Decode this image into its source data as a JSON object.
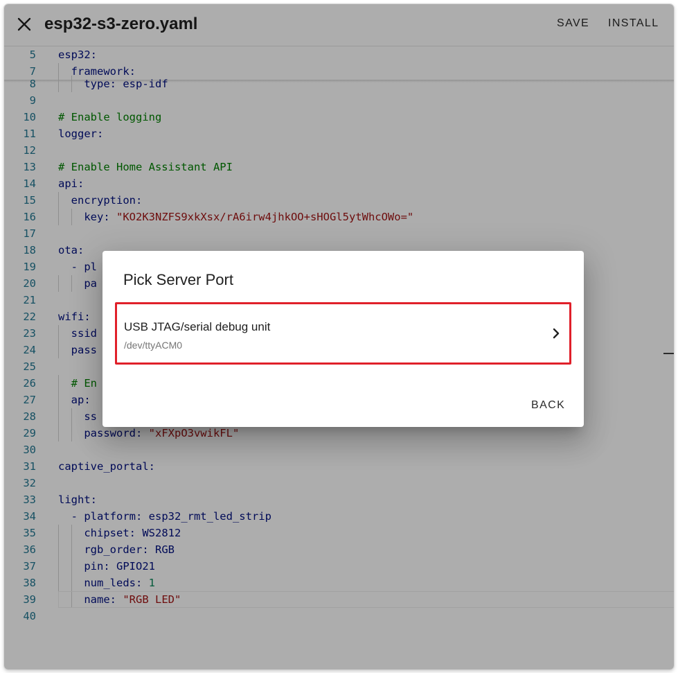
{
  "header": {
    "title": "esp32-s3-zero.yaml",
    "save_label": "SAVE",
    "install_label": "INSTALL",
    "close_icon": "close-icon"
  },
  "editor": {
    "lines": [
      {
        "n": "5",
        "parts": [
          {
            "t": "esp32",
            "c": "k"
          },
          {
            "t": ":",
            "c": "p"
          }
        ]
      },
      {
        "n": "7",
        "parts": [
          {
            "t": "  framework",
            "c": "k"
          },
          {
            "t": ":",
            "c": "p"
          }
        ]
      },
      {
        "n": "8",
        "parts": [
          {
            "t": "    type",
            "c": "k"
          },
          {
            "t": ": ",
            "c": "p"
          },
          {
            "t": "esp-idf",
            "c": "k"
          }
        ]
      },
      {
        "n": "9",
        "parts": []
      },
      {
        "n": "10",
        "parts": [
          {
            "t": "# Enable logging",
            "c": "c"
          }
        ]
      },
      {
        "n": "11",
        "parts": [
          {
            "t": "logger",
            "c": "k"
          },
          {
            "t": ":",
            "c": "p"
          }
        ]
      },
      {
        "n": "12",
        "parts": []
      },
      {
        "n": "13",
        "parts": [
          {
            "t": "# Enable Home Assistant API",
            "c": "c"
          }
        ]
      },
      {
        "n": "14",
        "parts": [
          {
            "t": "api",
            "c": "k"
          },
          {
            "t": ":",
            "c": "p"
          }
        ]
      },
      {
        "n": "15",
        "parts": [
          {
            "t": "  encryption",
            "c": "k"
          },
          {
            "t": ":",
            "c": "p"
          }
        ]
      },
      {
        "n": "16",
        "parts": [
          {
            "t": "    key",
            "c": "k"
          },
          {
            "t": ": ",
            "c": "p"
          },
          {
            "t": "\"KO2K3NZFS9xkXsx/rA6irw4jhkOO+sHOGl5ytWhcOWo=\"",
            "c": "s"
          }
        ]
      },
      {
        "n": "17",
        "parts": []
      },
      {
        "n": "18",
        "parts": [
          {
            "t": "ota",
            "c": "k"
          },
          {
            "t": ":",
            "c": "p"
          }
        ]
      },
      {
        "n": "19",
        "parts": [
          {
            "t": "  - pl",
            "c": "k"
          }
        ]
      },
      {
        "n": "20",
        "parts": [
          {
            "t": "    pa",
            "c": "k"
          }
        ]
      },
      {
        "n": "21",
        "parts": []
      },
      {
        "n": "22",
        "parts": [
          {
            "t": "wifi",
            "c": "k"
          },
          {
            "t": ":",
            "c": "p"
          }
        ]
      },
      {
        "n": "23",
        "parts": [
          {
            "t": "  ssid",
            "c": "k"
          }
        ]
      },
      {
        "n": "24",
        "parts": [
          {
            "t": "  pass",
            "c": "k"
          }
        ]
      },
      {
        "n": "25",
        "parts": []
      },
      {
        "n": "26",
        "parts": [
          {
            "t": "  # En",
            "c": "c"
          }
        ]
      },
      {
        "n": "27",
        "parts": [
          {
            "t": "  ap",
            "c": "k"
          },
          {
            "t": ":",
            "c": "p"
          }
        ]
      },
      {
        "n": "28",
        "parts": [
          {
            "t": "    ss",
            "c": "k"
          }
        ]
      },
      {
        "n": "29",
        "parts": [
          {
            "t": "    password",
            "c": "k"
          },
          {
            "t": ": ",
            "c": "p"
          },
          {
            "t": "\"xFXpO3vwikFL\"",
            "c": "s"
          }
        ]
      },
      {
        "n": "30",
        "parts": []
      },
      {
        "n": "31",
        "parts": [
          {
            "t": "captive_portal",
            "c": "k"
          },
          {
            "t": ":",
            "c": "p"
          }
        ]
      },
      {
        "n": "32",
        "parts": []
      },
      {
        "n": "33",
        "parts": [
          {
            "t": "light",
            "c": "k"
          },
          {
            "t": ":",
            "c": "p"
          }
        ]
      },
      {
        "n": "34",
        "parts": [
          {
            "t": "  - platform",
            "c": "k"
          },
          {
            "t": ": ",
            "c": "p"
          },
          {
            "t": "esp32_rmt_led_strip",
            "c": "k"
          }
        ]
      },
      {
        "n": "35",
        "parts": [
          {
            "t": "    chipset",
            "c": "k"
          },
          {
            "t": ": ",
            "c": "p"
          },
          {
            "t": "WS2812",
            "c": "k"
          }
        ]
      },
      {
        "n": "36",
        "parts": [
          {
            "t": "    rgb_order",
            "c": "k"
          },
          {
            "t": ": ",
            "c": "p"
          },
          {
            "t": "RGB",
            "c": "k"
          }
        ]
      },
      {
        "n": "37",
        "parts": [
          {
            "t": "    pin",
            "c": "k"
          },
          {
            "t": ": ",
            "c": "p"
          },
          {
            "t": "GPIO21",
            "c": "k"
          }
        ]
      },
      {
        "n": "38",
        "parts": [
          {
            "t": "    num_leds",
            "c": "k"
          },
          {
            "t": ": ",
            "c": "p"
          },
          {
            "t": "1",
            "c": "n"
          }
        ]
      },
      {
        "n": "39",
        "parts": [
          {
            "t": "    name",
            "c": "k"
          },
          {
            "t": ": ",
            "c": "p"
          },
          {
            "t": "\"RGB LED\"",
            "c": "s"
          }
        ]
      },
      {
        "n": "40",
        "parts": []
      }
    ]
  },
  "dialog": {
    "title": "Pick Server Port",
    "port": {
      "name": "USB JTAG/serial debug unit",
      "path": "/dev/ttyACM0"
    },
    "back_label": "BACK",
    "chevron_icon": "chevron-right-icon"
  },
  "colors": {
    "highlight_border": "#e0202a",
    "line_number": "#237893",
    "keyword": "#001080",
    "string": "#a31515",
    "comment": "#008000",
    "number": "#098658"
  }
}
